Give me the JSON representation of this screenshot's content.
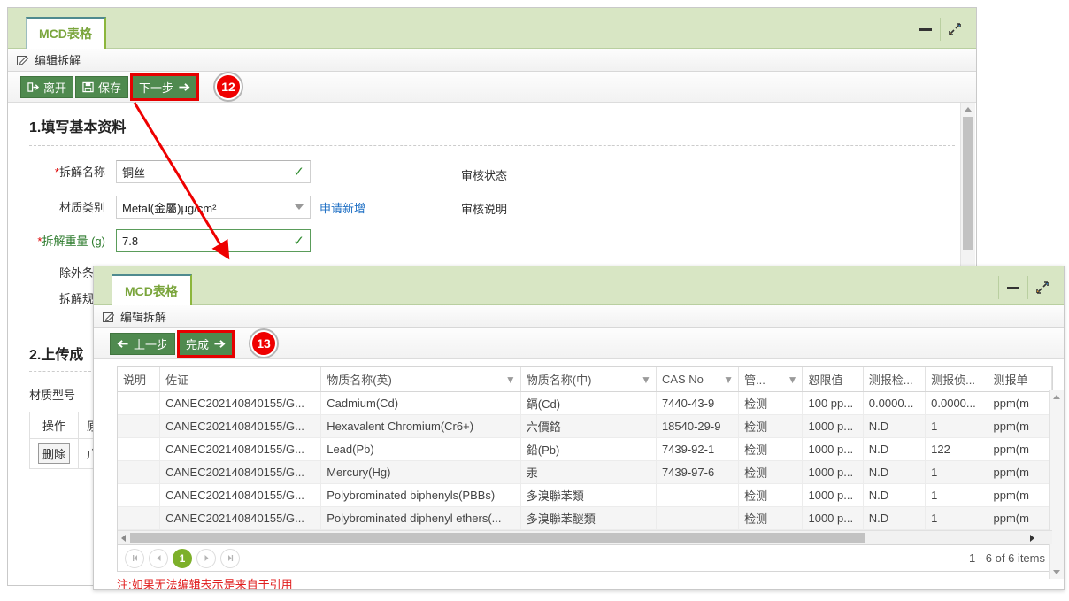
{
  "window1": {
    "tab_label": "MCD表格",
    "subbar_label": "编辑拆解",
    "minimize_icon": "minimize-icon",
    "maximize_icon": "maximize-icon",
    "toolbar": {
      "leave_label": "离开",
      "save_label": "保存",
      "next_label": "下一步",
      "leave_icon": "exit-icon",
      "save_icon": "save-disk-icon",
      "next_icon": "arrow-right-icon"
    },
    "marker": "12",
    "section1_title": "1.填写基本资料",
    "fields": {
      "name_label_req": "*",
      "name_label": "拆解名称",
      "name_value": "铜丝",
      "material_label": "材质类别",
      "material_value": "Metal(金屬)μg/cm²",
      "apply_new_link": "申请新增",
      "weight_label_req": "*",
      "weight_label": "拆解重量 (g)",
      "weight_value": "7.8",
      "exclusion_label": "除外条款",
      "spec_label": "拆解规范",
      "audit_status_label": "审核状态",
      "audit_note_label": "审核说明"
    },
    "section2_title": "2.上传成",
    "material_model_label": "材质型号",
    "mini_table": {
      "headers": [
        "操作",
        "原"
      ],
      "rows": [
        [
          "删除",
          "广"
        ]
      ]
    }
  },
  "window2": {
    "tab_label": "MCD表格",
    "subbar_label": "编辑拆解",
    "minimize_icon": "minimize-icon",
    "maximize_icon": "maximize-icon",
    "toolbar": {
      "prev_label": "上一步",
      "done_label": "完成",
      "prev_icon": "arrow-left-icon",
      "done_icon": "arrow-right-icon"
    },
    "marker": "13",
    "grid": {
      "columns": [
        {
          "label": "说明",
          "filter": false
        },
        {
          "label": "佐证",
          "filter": false
        },
        {
          "label": "物质名称(英)",
          "filter": true
        },
        {
          "label": "物质名称(中)",
          "filter": true
        },
        {
          "label": "CAS No",
          "filter": true
        },
        {
          "label": "管...",
          "filter": true
        },
        {
          "label": "恕限值",
          "filter": false
        },
        {
          "label": "测报检...",
          "filter": false
        },
        {
          "label": "测报侦...",
          "filter": false
        },
        {
          "label": "测报单",
          "filter": false
        }
      ],
      "rows": [
        [
          "",
          "CANEC202140840155/G...",
          "Cadmium(Cd)",
          "鎘(Cd)",
          "7440-43-9",
          "检测",
          "100 pp...",
          "0.0000...",
          "0.0000...",
          "ppm(m"
        ],
        [
          "",
          "CANEC202140840155/G...",
          "Hexavalent Chromium(Cr6+)",
          "六價鉻",
          "18540-29-9",
          "检测",
          "1000 p...",
          "N.D",
          "1",
          "ppm(m"
        ],
        [
          "",
          "CANEC202140840155/G...",
          "Lead(Pb)",
          "鉛(Pb)",
          "7439-92-1",
          "检测",
          "1000 p...",
          "N.D",
          "122",
          "ppm(m"
        ],
        [
          "",
          "CANEC202140840155/G...",
          "Mercury(Hg)",
          "汞",
          "7439-97-6",
          "检测",
          "1000 p...",
          "N.D",
          "1",
          "ppm(m"
        ],
        [
          "",
          "CANEC202140840155/G...",
          "Polybrominated biphenyls(PBBs)",
          "多溴聯苯類",
          "",
          "检测",
          "1000 p...",
          "N.D",
          "1",
          "ppm(m"
        ],
        [
          "",
          "CANEC202140840155/G...",
          "Polybrominated diphenyl ethers(...",
          "多溴聯苯醚類",
          "",
          "检测",
          "1000 p...",
          "N.D",
          "1",
          "ppm(m"
        ]
      ]
    },
    "pager": {
      "first_icon": "first-page-icon",
      "prev_icon": "prev-page-icon",
      "current_page": "1",
      "next_icon": "next-page-icon",
      "last_icon": "last-page-icon",
      "items_text": "1 - 6 of 6 items"
    },
    "note": "注:如果无法编辑表示是来自于引用"
  },
  "colors": {
    "accent_green": "#4f8a4f",
    "title_green": "#d8e6c4",
    "tab_text": "#7aa53c",
    "marker_red": "#ef0000",
    "highlight_red": "#e60000",
    "link_blue": "#3f7fbf",
    "note_red": "#e02020",
    "pager_green": "#7db02a"
  }
}
